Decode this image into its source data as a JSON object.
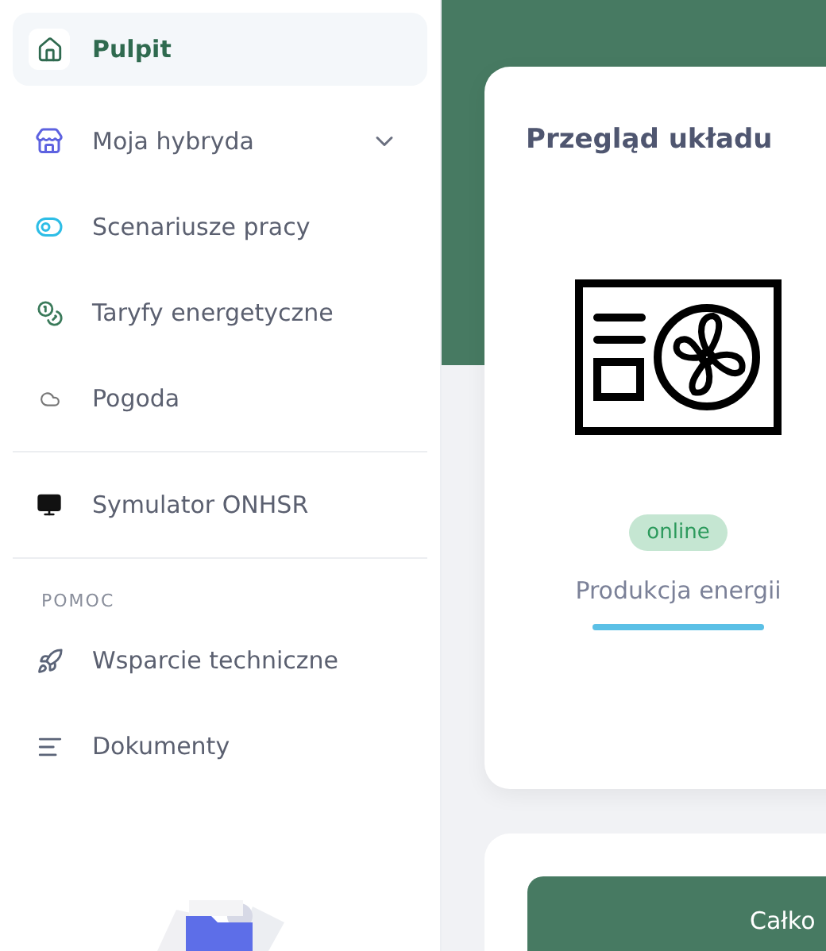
{
  "sidebar": {
    "sections": [
      {
        "items": [
          {
            "label": "Pulpit",
            "kind": "link",
            "selected": true
          },
          {
            "label": "Moja hybryda",
            "kind": "expandable",
            "selected": false
          },
          {
            "label": "Scenariusze pracy",
            "kind": "link",
            "selected": false
          },
          {
            "label": "Taryfy energetyczne",
            "kind": "link",
            "selected": false
          },
          {
            "label": "Pogoda",
            "kind": "link",
            "selected": false
          }
        ]
      },
      {
        "items": [
          {
            "label": "Symulator ONHSR",
            "kind": "link",
            "selected": false
          }
        ]
      },
      {
        "heading": "POMOC",
        "items": [
          {
            "label": "Wsparcie techniczne",
            "kind": "link",
            "selected": false
          },
          {
            "label": "Dokumenty",
            "kind": "link",
            "selected": false
          }
        ]
      }
    ]
  },
  "overview": {
    "title": "Przegląd układu",
    "status": "online",
    "label": "Produkcja energii",
    "level": 1
  },
  "summary": {
    "title": "Całko"
  }
}
